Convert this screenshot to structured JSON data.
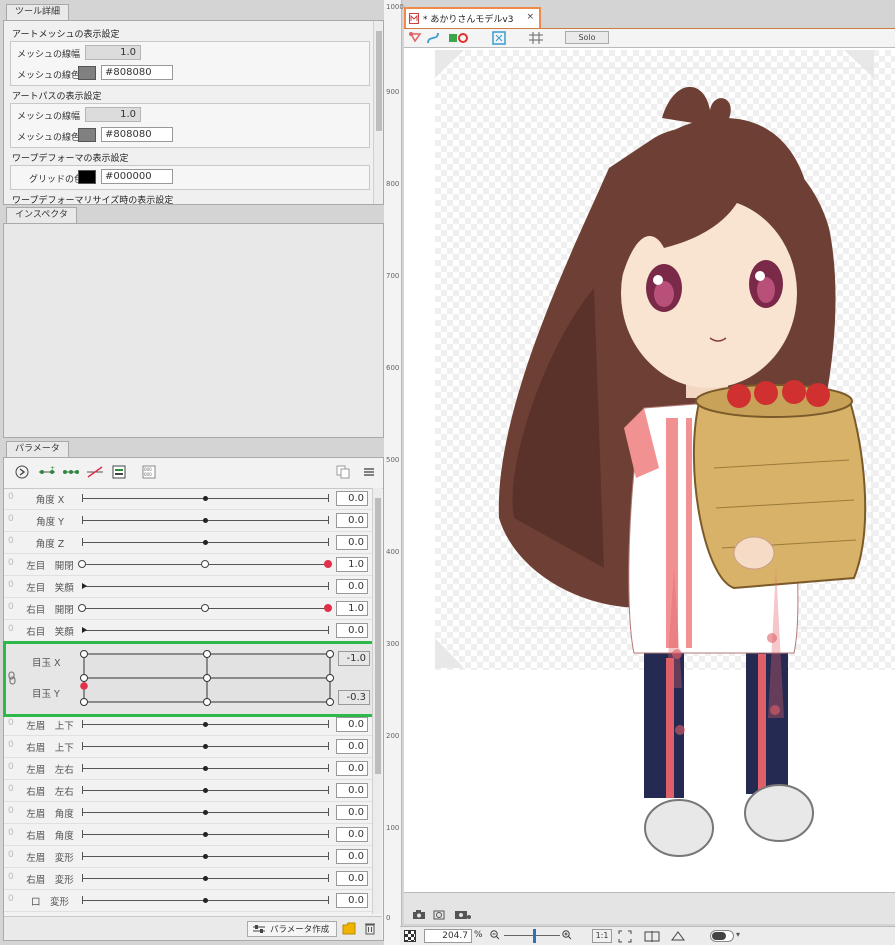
{
  "tool_details": {
    "tab": "ツール詳細",
    "sections": [
      {
        "title": "アートメッシュの表示設定",
        "width_label": "メッシュの線幅",
        "width_value": "1.0",
        "color_label": "メッシュの線色",
        "color_hex": "#808080",
        "swatch": "#808080"
      },
      {
        "title": "アートパスの表示設定",
        "width_label": "メッシュの線幅",
        "width_value": "1.0",
        "color_label": "メッシュの線色",
        "color_hex": "#808080",
        "swatch": "#808080"
      },
      {
        "title": "ワープデフォーマの表示設定",
        "color_label": "グリッドの色",
        "color_hex": "#000000",
        "swatch": "#000000"
      },
      {
        "title": "ワープデフォーマリサイズ時の表示設定"
      }
    ]
  },
  "inspector": {
    "tab": "インスペクタ"
  },
  "parameters": {
    "tab": "パラメータ",
    "rows": [
      {
        "zero": "0",
        "name": "角度 X",
        "value": "0.0"
      },
      {
        "zero": "0",
        "name": "角度 Y",
        "value": "0.0"
      },
      {
        "zero": "0",
        "name": "角度 Z",
        "value": "0.0"
      },
      {
        "zero": "0",
        "name": "左目　開閉",
        "value": "1.0"
      },
      {
        "zero": "0",
        "name": "左目　笑顔",
        "value": "0.0"
      },
      {
        "zero": "0",
        "name": "右目　開閉",
        "value": "1.0"
      },
      {
        "zero": "0",
        "name": "右目　笑顔",
        "value": "0.0"
      }
    ],
    "combined": {
      "name_x": "目玉 X",
      "name_y": "目玉 Y",
      "value_x": "-1.0",
      "value_y": "-0.3"
    },
    "rows_after": [
      {
        "zero": "0",
        "name": "左眉　上下",
        "value": "0.0"
      },
      {
        "zero": "0",
        "name": "右眉　上下",
        "value": "0.0"
      },
      {
        "zero": "0",
        "name": "左眉　左右",
        "value": "0.0"
      },
      {
        "zero": "0",
        "name": "右眉　左右",
        "value": "0.0"
      },
      {
        "zero": "0",
        "name": "左眉　角度",
        "value": "0.0"
      },
      {
        "zero": "0",
        "name": "右眉　角度",
        "value": "0.0"
      },
      {
        "zero": "0",
        "name": "左眉　変形",
        "value": "0.0"
      },
      {
        "zero": "0",
        "name": "右眉　変形",
        "value": "0.0"
      },
      {
        "zero": "0",
        "name": "口　変形",
        "value": "0.0"
      }
    ],
    "create_button": "パラメータ作成"
  },
  "document": {
    "tab_title": "* あかりさんモデルv3",
    "solo_label": "Solo",
    "zoom": "204.7",
    "zoom_unit": "%",
    "one_to_one": "1:1"
  },
  "ruler": [
    "1000",
    "900",
    "800",
    "700",
    "600",
    "500",
    "400",
    "300",
    "200",
    "100",
    "0"
  ],
  "colors": {
    "highlight": "#2db84a",
    "active_tab_border": "#f08a4b",
    "key_active": "#e0304a"
  }
}
